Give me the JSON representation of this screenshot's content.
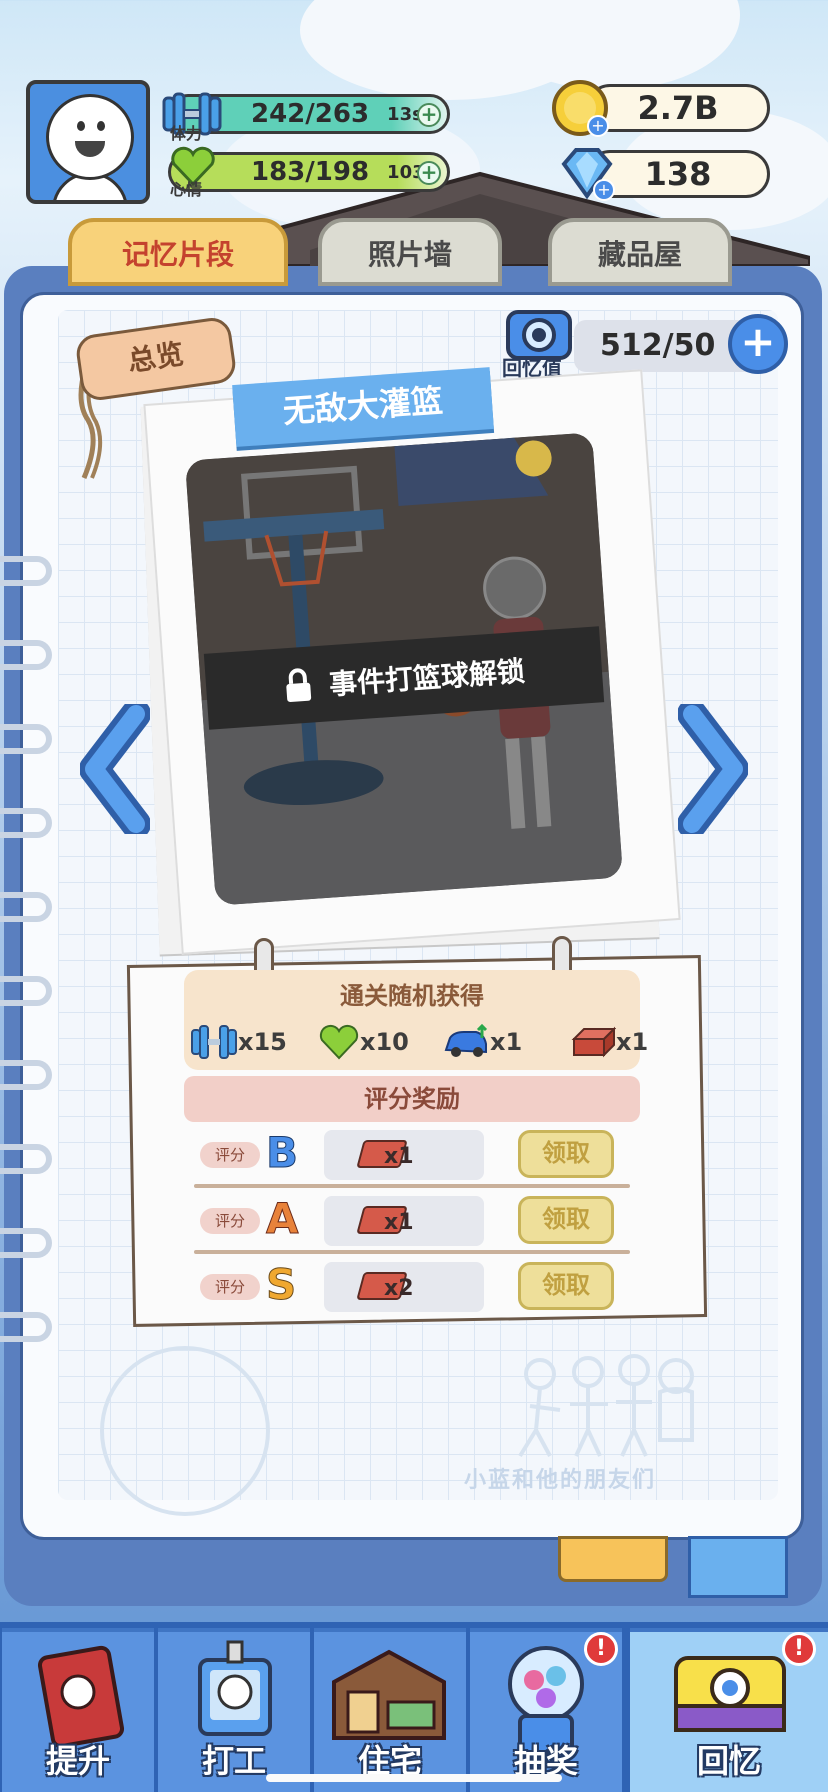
{
  "hud": {
    "stamina": {
      "label": "体力",
      "value": "242/263",
      "timer": "13s"
    },
    "mood": {
      "label": "心情",
      "value": "183/198",
      "timer": "103s"
    },
    "coins": "2.7B",
    "gems": "138"
  },
  "tabs": [
    {
      "label": "记忆片段",
      "active": true
    },
    {
      "label": "照片墙",
      "active": false
    },
    {
      "label": "藏品屋",
      "active": false
    }
  ],
  "overview_tag": "总览",
  "memory": {
    "label": "回忆值",
    "count": "512/50"
  },
  "photo": {
    "title": "无敌大灌篮",
    "lock_text": "事件打篮球解锁"
  },
  "loot": {
    "title": "通关随机获得",
    "items": [
      {
        "icon": "dumbbell-icon",
        "qty": "x15"
      },
      {
        "icon": "heart-icon",
        "qty": "x10"
      },
      {
        "icon": "car-icon",
        "qty": "x1"
      },
      {
        "icon": "brick-icon",
        "qty": "x1"
      }
    ]
  },
  "score_rewards": {
    "title": "评分奖励",
    "rows": [
      {
        "pill": "评分",
        "grade": "B",
        "grade_color": "#4a8ee8",
        "qty": "x1",
        "claim": "领取"
      },
      {
        "pill": "评分",
        "grade": "A",
        "grade_color": "#e8823a",
        "qty": "x1",
        "claim": "领取"
      },
      {
        "pill": "评分",
        "grade": "S",
        "grade_color": "#f0a830",
        "qty": "x2",
        "claim": "领取"
      }
    ]
  },
  "watermark": "小蓝和他的朋友们",
  "nav": [
    {
      "label": "提升",
      "badge": false
    },
    {
      "label": "打工",
      "badge": false
    },
    {
      "label": "住宅",
      "badge": false
    },
    {
      "label": "抽奖",
      "badge": true
    },
    {
      "label": "回忆",
      "badge": true,
      "active": true
    }
  ],
  "colors": {
    "accent": "#4a8ee8",
    "stamina": "#5fd0b8",
    "mood": "#b6dd5a"
  }
}
